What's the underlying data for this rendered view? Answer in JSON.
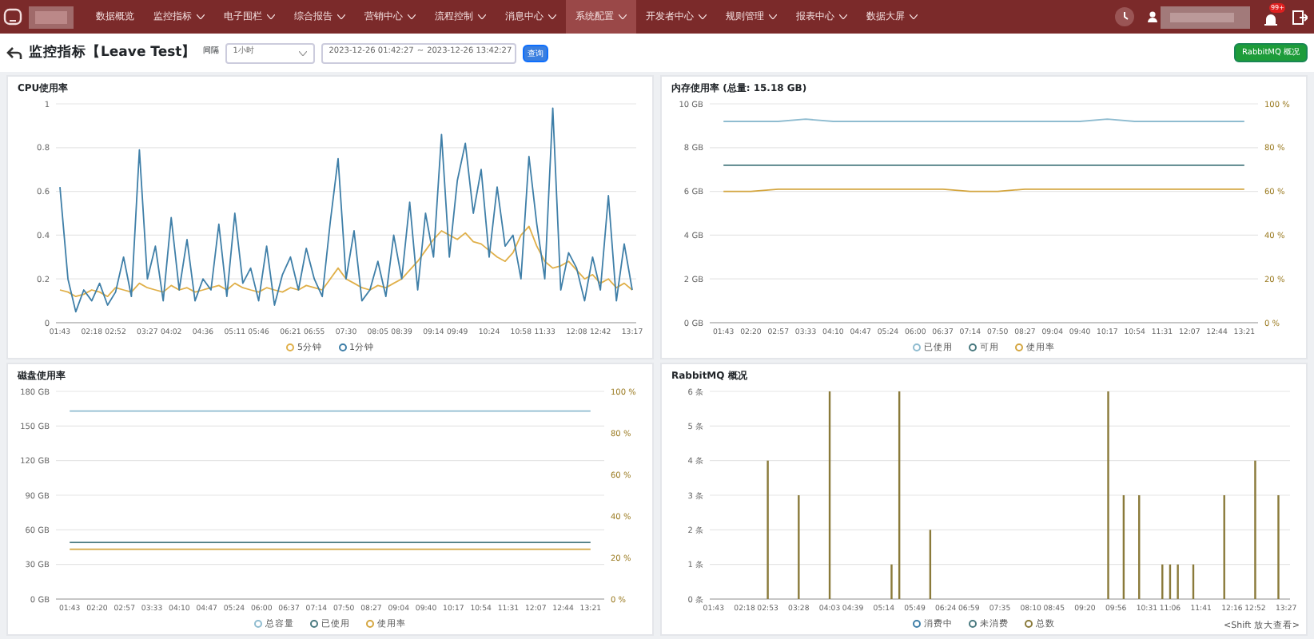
{
  "header": {
    "menu": [
      {
        "label": "数据概览",
        "dropdown": false,
        "selected": false
      },
      {
        "label": "监控指标",
        "dropdown": true,
        "selected": false
      },
      {
        "label": "电子围栏",
        "dropdown": true,
        "selected": false
      },
      {
        "label": "综合报告",
        "dropdown": true,
        "selected": false
      },
      {
        "label": "营销中心",
        "dropdown": true,
        "selected": false
      },
      {
        "label": "流程控制",
        "dropdown": true,
        "selected": false
      },
      {
        "label": "消息中心",
        "dropdown": true,
        "selected": false
      },
      {
        "label": "系统配置",
        "dropdown": true,
        "selected": true
      },
      {
        "label": "开发者中心",
        "dropdown": true,
        "selected": false
      },
      {
        "label": "规则管理",
        "dropdown": true,
        "selected": false
      },
      {
        "label": "报表中心",
        "dropdown": true,
        "selected": false
      },
      {
        "label": "数据大屏",
        "dropdown": true,
        "selected": false
      }
    ],
    "notification_badge": "99+"
  },
  "toolbar": {
    "title": "监控指标【Leave Test】",
    "interval_label": "间隔",
    "interval_value": "1小时",
    "date_start": "2023-12-26 01:42:27",
    "date_separator": "~",
    "date_end": "2023-12-26 13:42:27",
    "query_button": "查询",
    "rabbitmq_button": "RabbitMQ 概况"
  },
  "panels": [
    {
      "title": "CPU使用率",
      "chart_data": {
        "type": "line",
        "grid": true,
        "ylim": [
          0,
          1
        ],
        "categories": [
          "01:43",
          null,
          null,
          null,
          "02:18",
          null,
          null,
          "02:52",
          null,
          null,
          null,
          "03:27",
          null,
          null,
          "04:02",
          null,
          null,
          null,
          "04:36",
          null,
          null,
          null,
          "05:11",
          null,
          null,
          "05:46",
          null,
          null,
          null,
          "06:21",
          null,
          null,
          "06:55",
          null,
          null,
          null,
          "07:30",
          null,
          null,
          null,
          "08:05",
          null,
          null,
          "08:39",
          null,
          null,
          null,
          "09:14",
          null,
          null,
          "09:49",
          null,
          null,
          null,
          "10:24",
          null,
          null,
          null,
          "10:58",
          null,
          null,
          "11:33",
          null,
          null,
          null,
          "12:08",
          null,
          null,
          "12:42",
          null,
          null,
          null,
          "13:17"
        ],
        "yticks": [
          {
            "value": 0,
            "label": "0"
          },
          {
            "value": 0.2,
            "label": "0.2"
          },
          {
            "value": 0.4,
            "label": "0.4"
          },
          {
            "value": 0.6,
            "label": "0.6"
          },
          {
            "value": 0.8,
            "label": "0.8"
          },
          {
            "value": 1,
            "label": "1"
          }
        ],
        "series": [
          {
            "name": "5分钟",
            "color": "#e0b04a",
            "values": [
              0.15,
              0.14,
              0.12,
              0.13,
              0.15,
              0.14,
              0.12,
              0.16,
              0.15,
              0.14,
              0.18,
              0.16,
              0.15,
              0.14,
              0.17,
              0.15,
              0.16,
              0.14,
              0.15,
              0.16,
              0.17,
              0.15,
              0.18,
              0.16,
              0.15,
              0.14,
              0.16,
              0.15,
              0.14,
              0.16,
              0.15,
              0.17,
              0.16,
              0.15,
              0.2,
              0.25,
              0.2,
              0.18,
              0.16,
              0.15,
              0.17,
              0.16,
              0.18,
              0.2,
              0.24,
              0.28,
              0.33,
              0.38,
              0.42,
              0.4,
              0.38,
              0.41,
              0.37,
              0.36,
              0.33,
              0.3,
              0.28,
              0.32,
              0.4,
              0.44,
              0.35,
              0.28,
              0.25,
              0.26,
              0.28,
              0.24,
              0.2,
              0.22,
              0.18,
              0.2,
              0.16,
              0.18,
              0.15
            ]
          },
          {
            "name": "1分钟",
            "color": "#3f7fa8",
            "values": [
              0.62,
              0.2,
              0.05,
              0.15,
              0.1,
              0.18,
              0.08,
              0.14,
              0.3,
              0.12,
              0.79,
              0.2,
              0.35,
              0.1,
              0.48,
              0.15,
              0.38,
              0.1,
              0.2,
              0.15,
              0.45,
              0.12,
              0.5,
              0.18,
              0.25,
              0.1,
              0.35,
              0.08,
              0.22,
              0.3,
              0.15,
              0.34,
              0.2,
              0.12,
              0.46,
              0.75,
              0.2,
              0.42,
              0.1,
              0.15,
              0.28,
              0.12,
              0.4,
              0.2,
              0.55,
              0.15,
              0.5,
              0.3,
              0.86,
              0.3,
              0.65,
              0.82,
              0.5,
              0.7,
              0.3,
              0.62,
              0.35,
              0.4,
              0.2,
              0.76,
              0.45,
              0.2,
              0.98,
              0.15,
              0.32,
              0.25,
              0.1,
              0.3,
              0.15,
              0.58,
              0.1,
              0.36,
              0.15
            ]
          }
        ]
      }
    },
    {
      "title": "内存使用率 (总量: 15.18 GB)",
      "chart_data": {
        "type": "line",
        "grid": true,
        "ylim": [
          0,
          10
        ],
        "yticks": [
          {
            "value": 0,
            "label": "0 GB"
          },
          {
            "value": 2,
            "label": "2 GB"
          },
          {
            "value": 4,
            "label": "4 GB"
          },
          {
            "value": 6,
            "label": "6 GB"
          },
          {
            "value": 8,
            "label": "8 GB"
          },
          {
            "value": 10,
            "label": "10 GB"
          }
        ],
        "y2lim": [
          0,
          100
        ],
        "y2ticks": [
          {
            "value": 0,
            "label": "0 %"
          },
          {
            "value": 20,
            "label": "20 %"
          },
          {
            "value": 40,
            "label": "40 %"
          },
          {
            "value": 60,
            "label": "60 %"
          },
          {
            "value": 80,
            "label": "80 %"
          },
          {
            "value": 100,
            "label": "100 %"
          }
        ],
        "categories": [
          "01:43",
          "02:20",
          "02:57",
          "03:33",
          "04:10",
          "04:47",
          "05:24",
          "06:00",
          "06:37",
          "07:14",
          "07:50",
          "08:27",
          "09:04",
          "09:40",
          "10:17",
          "10:54",
          "11:31",
          "12:07",
          "12:44",
          "13:21"
        ],
        "series": [
          {
            "name": "已使用",
            "color": "#8fbcd0",
            "values": [
              9.2,
              9.2,
              9.2,
              9.3,
              9.2,
              9.2,
              9.2,
              9.2,
              9.2,
              9.2,
              9.2,
              9.2,
              9.2,
              9.2,
              9.3,
              9.2,
              9.2,
              9.2,
              9.2,
              9.2
            ]
          },
          {
            "name": "可用",
            "color": "#4a7a80",
            "values": [
              7.2,
              7.2,
              7.2,
              7.2,
              7.2,
              7.2,
              7.2,
              7.2,
              7.2,
              7.2,
              7.2,
              7.2,
              7.2,
              7.2,
              7.2,
              7.2,
              7.2,
              7.2,
              7.2,
              7.2
            ]
          },
          {
            "name": "使用率",
            "color": "#d4a640",
            "axis": "y2",
            "values": [
              60,
              60,
              61,
              61,
              61,
              61,
              61,
              61,
              61,
              60,
              60,
              61,
              61,
              61,
              61,
              61,
              61,
              61,
              61,
              61
            ]
          }
        ]
      }
    },
    {
      "title": "磁盘使用率",
      "chart_data": {
        "type": "line",
        "grid": true,
        "ylim": [
          0,
          180
        ],
        "yticks": [
          {
            "value": 0,
            "label": "0 GB"
          },
          {
            "value": 30,
            "label": "30 GB"
          },
          {
            "value": 60,
            "label": "60 GB"
          },
          {
            "value": 90,
            "label": "90 GB"
          },
          {
            "value": 120,
            "label": "120 GB"
          },
          {
            "value": 150,
            "label": "150 GB"
          },
          {
            "value": 180,
            "label": "180 GB"
          }
        ],
        "y2lim": [
          0,
          100
        ],
        "y2ticks": [
          {
            "value": 0,
            "label": "0 %"
          },
          {
            "value": 20,
            "label": "20 %"
          },
          {
            "value": 40,
            "label": "40 %"
          },
          {
            "value": 60,
            "label": "60 %"
          },
          {
            "value": 80,
            "label": "80 %"
          },
          {
            "value": 100,
            "label": "100 %"
          }
        ],
        "categories": [
          "01:43",
          "02:20",
          "02:57",
          "03:33",
          "04:10",
          "04:47",
          "05:24",
          "06:00",
          "06:37",
          "07:14",
          "07:50",
          "08:27",
          "09:04",
          "09:40",
          "10:17",
          "10:54",
          "11:31",
          "12:07",
          "12:44",
          "13:21"
        ],
        "series": [
          {
            "name": "总容量",
            "color": "#8fbcd0",
            "values": [
              163,
              163,
              163,
              163,
              163,
              163,
              163,
              163,
              163,
              163,
              163,
              163,
              163,
              163,
              163,
              163,
              163,
              163,
              163,
              163
            ]
          },
          {
            "name": "已使用",
            "color": "#4a7a80",
            "values": [
              49,
              49,
              49,
              49,
              49,
              49,
              49,
              49,
              49,
              49,
              49,
              49,
              49,
              49,
              49,
              49,
              49,
              49,
              49,
              49
            ]
          },
          {
            "name": "使用率",
            "color": "#d4a640",
            "axis": "y2",
            "values": [
              24,
              24,
              24,
              24,
              24,
              24,
              24,
              24,
              24,
              24,
              24,
              24,
              24,
              24,
              24,
              24,
              24,
              24,
              24,
              24
            ]
          }
        ]
      }
    },
    {
      "title": "RabbitMQ 概况",
      "chart_data": {
        "type": "bar",
        "grid": true,
        "ylim": [
          0,
          6
        ],
        "categories": [
          "01:43",
          null,
          null,
          null,
          "02:18",
          null,
          null,
          "02:53",
          null,
          null,
          null,
          "03:28",
          null,
          null,
          null,
          "04:03",
          null,
          null,
          "04:39",
          null,
          null,
          null,
          "05:14",
          null,
          null,
          null,
          "05:49",
          null,
          null,
          null,
          "06:24",
          null,
          null,
          "06:59",
          null,
          null,
          null,
          "07:35",
          null,
          null,
          null,
          "08:10",
          null,
          null,
          "08:45",
          null,
          null,
          null,
          "09:20",
          null,
          null,
          null,
          "09:56",
          null,
          null,
          null,
          "10:31",
          null,
          null,
          "11:06",
          null,
          null,
          null,
          "11:41",
          null,
          null,
          null,
          "12:16",
          null,
          null,
          "12:52",
          null,
          null,
          null,
          "13:27"
        ],
        "yticks": [
          {
            "value": 0,
            "label": "0 条"
          },
          {
            "value": 1,
            "label": "1 条"
          },
          {
            "value": 2,
            "label": "2 条"
          },
          {
            "value": 3,
            "label": "3 条"
          },
          {
            "value": 4,
            "label": "4 条"
          },
          {
            "value": 5,
            "label": "5 条"
          },
          {
            "value": 6,
            "label": "6 条"
          }
        ],
        "series": [
          {
            "name": "消费中",
            "color": "#3f7fa8",
            "values": [
              0,
              0,
              0,
              0,
              0,
              0,
              0,
              0,
              0,
              0,
              0,
              0,
              0,
              0,
              0,
              0,
              0,
              0,
              0,
              0,
              0,
              0,
              0,
              0,
              0,
              0,
              0,
              0,
              0,
              0,
              0,
              0,
              0,
              0,
              0,
              0,
              0,
              0,
              0,
              0,
              0,
              0,
              0,
              0,
              0,
              0,
              0,
              0,
              0,
              0,
              0,
              0,
              0,
              0,
              0,
              0,
              0,
              0,
              0,
              0,
              0,
              0,
              0,
              0,
              0,
              0,
              0,
              0,
              0,
              0,
              0,
              0,
              0,
              0,
              0
            ]
          },
          {
            "name": "未消费",
            "color": "#4a7a80",
            "values": [
              0,
              0,
              0,
              0,
              0,
              0,
              0,
              0,
              0,
              0,
              0,
              0,
              0,
              0,
              0,
              0,
              0,
              0,
              0,
              0,
              0,
              0,
              0,
              0,
              0,
              0,
              0,
              0,
              0,
              0,
              0,
              0,
              0,
              0,
              0,
              0,
              0,
              0,
              0,
              0,
              0,
              0,
              0,
              0,
              0,
              0,
              0,
              0,
              0,
              0,
              0,
              0,
              0,
              0,
              0,
              0,
              0,
              0,
              0,
              0,
              0,
              0,
              0,
              0,
              0,
              0,
              0,
              0,
              0,
              0,
              0,
              0,
              0,
              0,
              0
            ]
          },
          {
            "name": "总数",
            "color": "#8a7a3a",
            "values": [
              0,
              0,
              0,
              0,
              0,
              0,
              0,
              4,
              0,
              0,
              0,
              3,
              0,
              0,
              0,
              6,
              0,
              0,
              0,
              0,
              0,
              0,
              0,
              1,
              6,
              0,
              0,
              0,
              2,
              0,
              0,
              0,
              0,
              0,
              0,
              0,
              0,
              0,
              0,
              0,
              0,
              0,
              0,
              0,
              0,
              0,
              0,
              0,
              0,
              0,
              0,
              6,
              0,
              3,
              0,
              3,
              0,
              0,
              1,
              1,
              1,
              0,
              1,
              0,
              0,
              0,
              3,
              0,
              0,
              0,
              4,
              0,
              0,
              3,
              0
            ]
          }
        ]
      },
      "hint": "<Shift 放大查看>"
    }
  ]
}
